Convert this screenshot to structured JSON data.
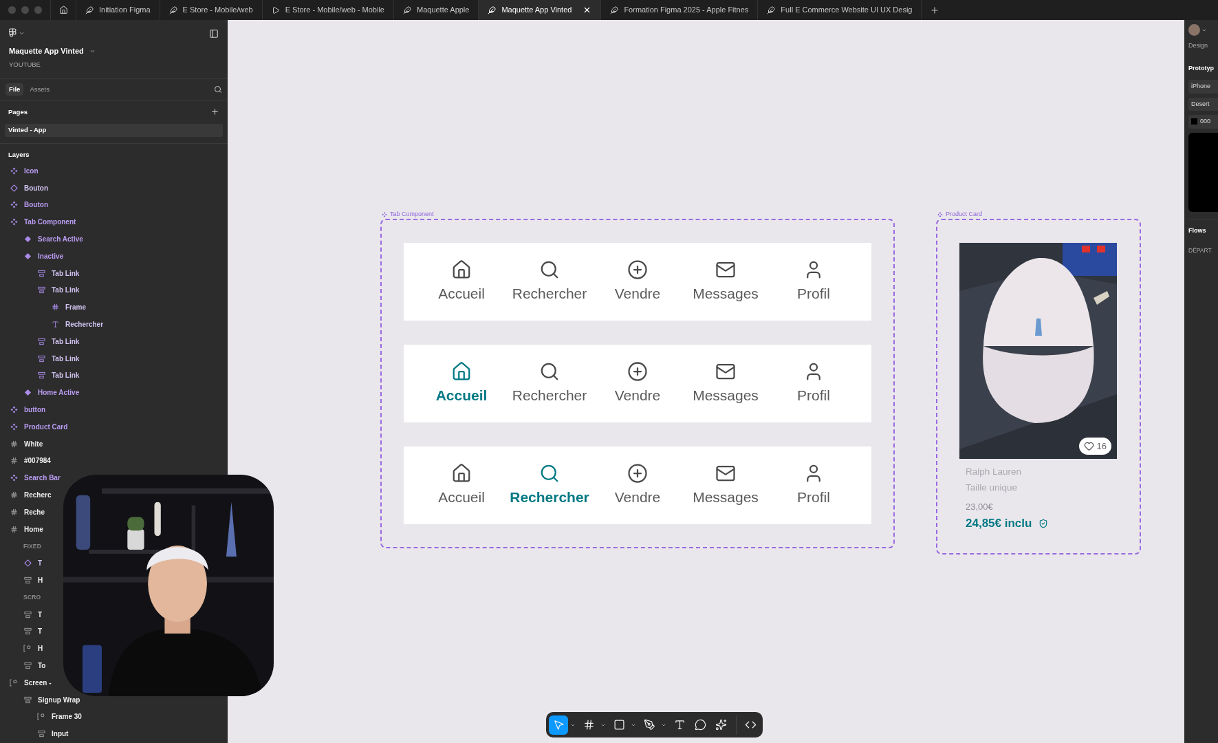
{
  "browser_tabs": [
    {
      "title": "Initiation Figma",
      "kind": "design",
      "selected": false
    },
    {
      "title": "E Store - Mobile/web",
      "kind": "design",
      "selected": false
    },
    {
      "title": "E Store - Mobile/web - Mobile",
      "kind": "prototype",
      "selected": false
    },
    {
      "title": "Maquette Apple",
      "kind": "design",
      "selected": false
    },
    {
      "title": "Maquette App Vinted",
      "kind": "design",
      "selected": true
    },
    {
      "title": "Formation Figma 2025 - Apple Fitnes",
      "kind": "design",
      "selected": false
    },
    {
      "title": "Full E Commerce Website UI UX Desig",
      "kind": "design",
      "selected": false
    }
  ],
  "sidebar": {
    "file_name": "Maquette App Vinted",
    "team": "YOUTUBE",
    "tabs": [
      {
        "label": "File",
        "selected": true
      },
      {
        "label": "Assets",
        "selected": false
      }
    ],
    "pages_heading": "Pages",
    "pages": [
      {
        "name": "Vinted - App",
        "selected": true
      }
    ],
    "layers_heading": "Layers",
    "layers": [
      {
        "name": "Icon",
        "kind": "component"
      },
      {
        "name": "Bouton",
        "kind": "instance"
      },
      {
        "name": "Bouton",
        "kind": "component"
      },
      {
        "name": "Tab Component",
        "kind": "component",
        "children": [
          {
            "name": "Search Active",
            "kind": "variant"
          },
          {
            "name": "Inactive",
            "kind": "variant",
            "children": [
              {
                "name": "Tab Link",
                "kind": "stack"
              },
              {
                "name": "Tab Link",
                "kind": "stack",
                "children": [
                  {
                    "name": "Frame",
                    "kind": "frame"
                  },
                  {
                    "name": "Rechercher",
                    "kind": "text"
                  }
                ]
              },
              {
                "name": "Tab Link",
                "kind": "stack"
              },
              {
                "name": "Tab Link",
                "kind": "stack"
              },
              {
                "name": "Tab Link",
                "kind": "stack"
              }
            ]
          },
          {
            "name": "Home Active",
            "kind": "variant"
          }
        ]
      },
      {
        "name": "button",
        "kind": "component"
      },
      {
        "name": "Product Card",
        "kind": "component"
      },
      {
        "name": "White",
        "kind": "frame"
      },
      {
        "name": "#007984",
        "kind": "frame"
      },
      {
        "name": "Search Bar",
        "kind": "component"
      },
      {
        "name": "Recherc",
        "kind": "frame"
      },
      {
        "name": "Reche",
        "kind": "frame"
      },
      {
        "name": "Home",
        "kind": "frame",
        "children": [
          {
            "name": "FIXED",
            "kind": "section"
          },
          {
            "name": "T",
            "kind": "instance"
          },
          {
            "name": "H",
            "kind": "stack"
          },
          {
            "name": "SCRO",
            "kind": "section"
          },
          {
            "name": "T",
            "kind": "stack"
          },
          {
            "name": "T",
            "kind": "stack"
          },
          {
            "name": "H",
            "kind": "screen"
          },
          {
            "name": "To",
            "kind": "stack"
          }
        ]
      },
      {
        "name": "Screen -",
        "kind": "screen",
        "children": [
          {
            "name": "Signup Wrap",
            "kind": "stack",
            "children": [
              {
                "name": "Frame 30",
                "kind": "screen"
              },
              {
                "name": "Input",
                "kind": "stack"
              }
            ]
          }
        ]
      }
    ]
  },
  "canvas": {
    "tab_component": {
      "label": "Tab Component",
      "rows": [
        {
          "tabs": [
            {
              "label": "Accueil",
              "kind": "home",
              "selected": false
            },
            {
              "label": "Rechercher",
              "kind": "search",
              "selected": false
            },
            {
              "label": "Vendre",
              "kind": "sell",
              "selected": false
            },
            {
              "label": "Messages",
              "kind": "mail",
              "selected": false
            },
            {
              "label": "Profil",
              "kind": "profile",
              "selected": false
            }
          ]
        },
        {
          "tabs": [
            {
              "label": "Accueil",
              "kind": "home",
              "selected": true
            },
            {
              "label": "Rechercher",
              "kind": "search",
              "selected": false
            },
            {
              "label": "Vendre",
              "kind": "sell",
              "selected": false
            },
            {
              "label": "Messages",
              "kind": "mail",
              "selected": false
            },
            {
              "label": "Profil",
              "kind": "profile",
              "selected": false
            }
          ]
        },
        {
          "tabs": [
            {
              "label": "Accueil",
              "kind": "home",
              "selected": false
            },
            {
              "label": "Rechercher",
              "kind": "search",
              "selected": true
            },
            {
              "label": "Vendre",
              "kind": "sell",
              "selected": false
            },
            {
              "label": "Messages",
              "kind": "mail",
              "selected": false
            },
            {
              "label": "Profil",
              "kind": "profile",
              "selected": false
            }
          ]
        }
      ]
    },
    "product_card": {
      "label": "Product Card",
      "likes": "16",
      "brand": "Ralph Lauren",
      "size": "Taille unique",
      "price": "23,00€",
      "price_total": "24,85€ inclu"
    }
  },
  "right_panel": {
    "tabs": [
      "Design",
      "Prototyp"
    ],
    "device": "iPhone",
    "model": "Desert",
    "fill_value": "000",
    "flows_heading": "Flows",
    "flow": "DÉPART"
  },
  "toolbar": {
    "tools": [
      {
        "kind": "move",
        "selected": true
      },
      {
        "kind": "frame",
        "selected": false
      },
      {
        "kind": "shape",
        "selected": false
      },
      {
        "kind": "pen",
        "selected": false
      },
      {
        "kind": "text",
        "selected": false
      },
      {
        "kind": "comment",
        "selected": false
      },
      {
        "kind": "actions",
        "selected": false
      },
      {
        "kind": "dev",
        "selected": false
      }
    ]
  }
}
